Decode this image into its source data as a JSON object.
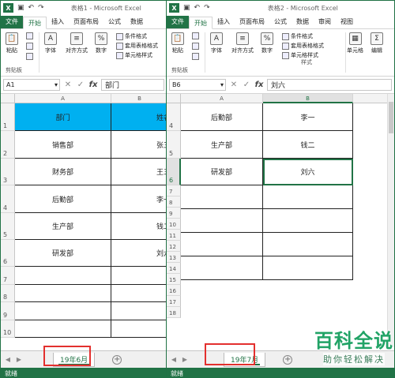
{
  "window1": {
    "title": "表格1 - Microsoft Excel",
    "tabs": [
      "文件",
      "开始",
      "插入",
      "页面布局",
      "公式",
      "数据"
    ],
    "ribbon": {
      "paste": "粘贴",
      "font": "字体",
      "align": "对齐方式",
      "number": "数字",
      "cond_format": "条件格式",
      "table_format": "套用表格格式",
      "cell_style": "单元格样式",
      "clipboard_group": "剪贴板"
    },
    "namebox": "A1",
    "formula_value": "部门",
    "columns": [
      "A",
      "B"
    ],
    "rows": [
      "1",
      "2",
      "3",
      "4",
      "5",
      "6",
      "7",
      "8",
      "9",
      "10"
    ],
    "cells": [
      [
        "部门",
        "姓名"
      ],
      [
        "销售部",
        "张三"
      ],
      [
        "财务部",
        "王五"
      ],
      [
        "后勤部",
        "李一"
      ],
      [
        "生产部",
        "钱二"
      ],
      [
        "研发部",
        "刘六"
      ]
    ],
    "sheet_tab": "19年6月",
    "status": "就绪"
  },
  "window2": {
    "title": "表格2 - Microsoft Excel",
    "tabs": [
      "文件",
      "开始",
      "插入",
      "页面布局",
      "公式",
      "数据",
      "审阅",
      "视图"
    ],
    "ribbon": {
      "paste": "粘贴",
      "font": "字体",
      "align": "对齐方式",
      "number": "数字",
      "cond_format": "条件格式",
      "table_format": "套用表格格式",
      "cell_style": "单元格样式",
      "cells": "单元格",
      "edit": "编辑",
      "clipboard_group": "剪贴板",
      "style_group": "样式"
    },
    "namebox": "B6",
    "formula_value": "刘六",
    "columns": [
      "A",
      "B"
    ],
    "rows": [
      "4",
      "5",
      "6",
      "7",
      "8",
      "9",
      "10",
      "11",
      "12",
      "13",
      "14",
      "15",
      "16",
      "17",
      "18"
    ],
    "cells": [
      [
        "后勤部",
        "李一"
      ],
      [
        "生产部",
        "钱二"
      ],
      [
        "研发部",
        "刘六"
      ]
    ],
    "sheet_tab": "19年7月",
    "status": "就绪"
  },
  "watermark": {
    "line1": "百科全说",
    "line2": "助你轻松解决"
  },
  "colors": {
    "excel_green": "#217346",
    "header_fill": "#00b0f0",
    "highlight": "#e3302e"
  }
}
